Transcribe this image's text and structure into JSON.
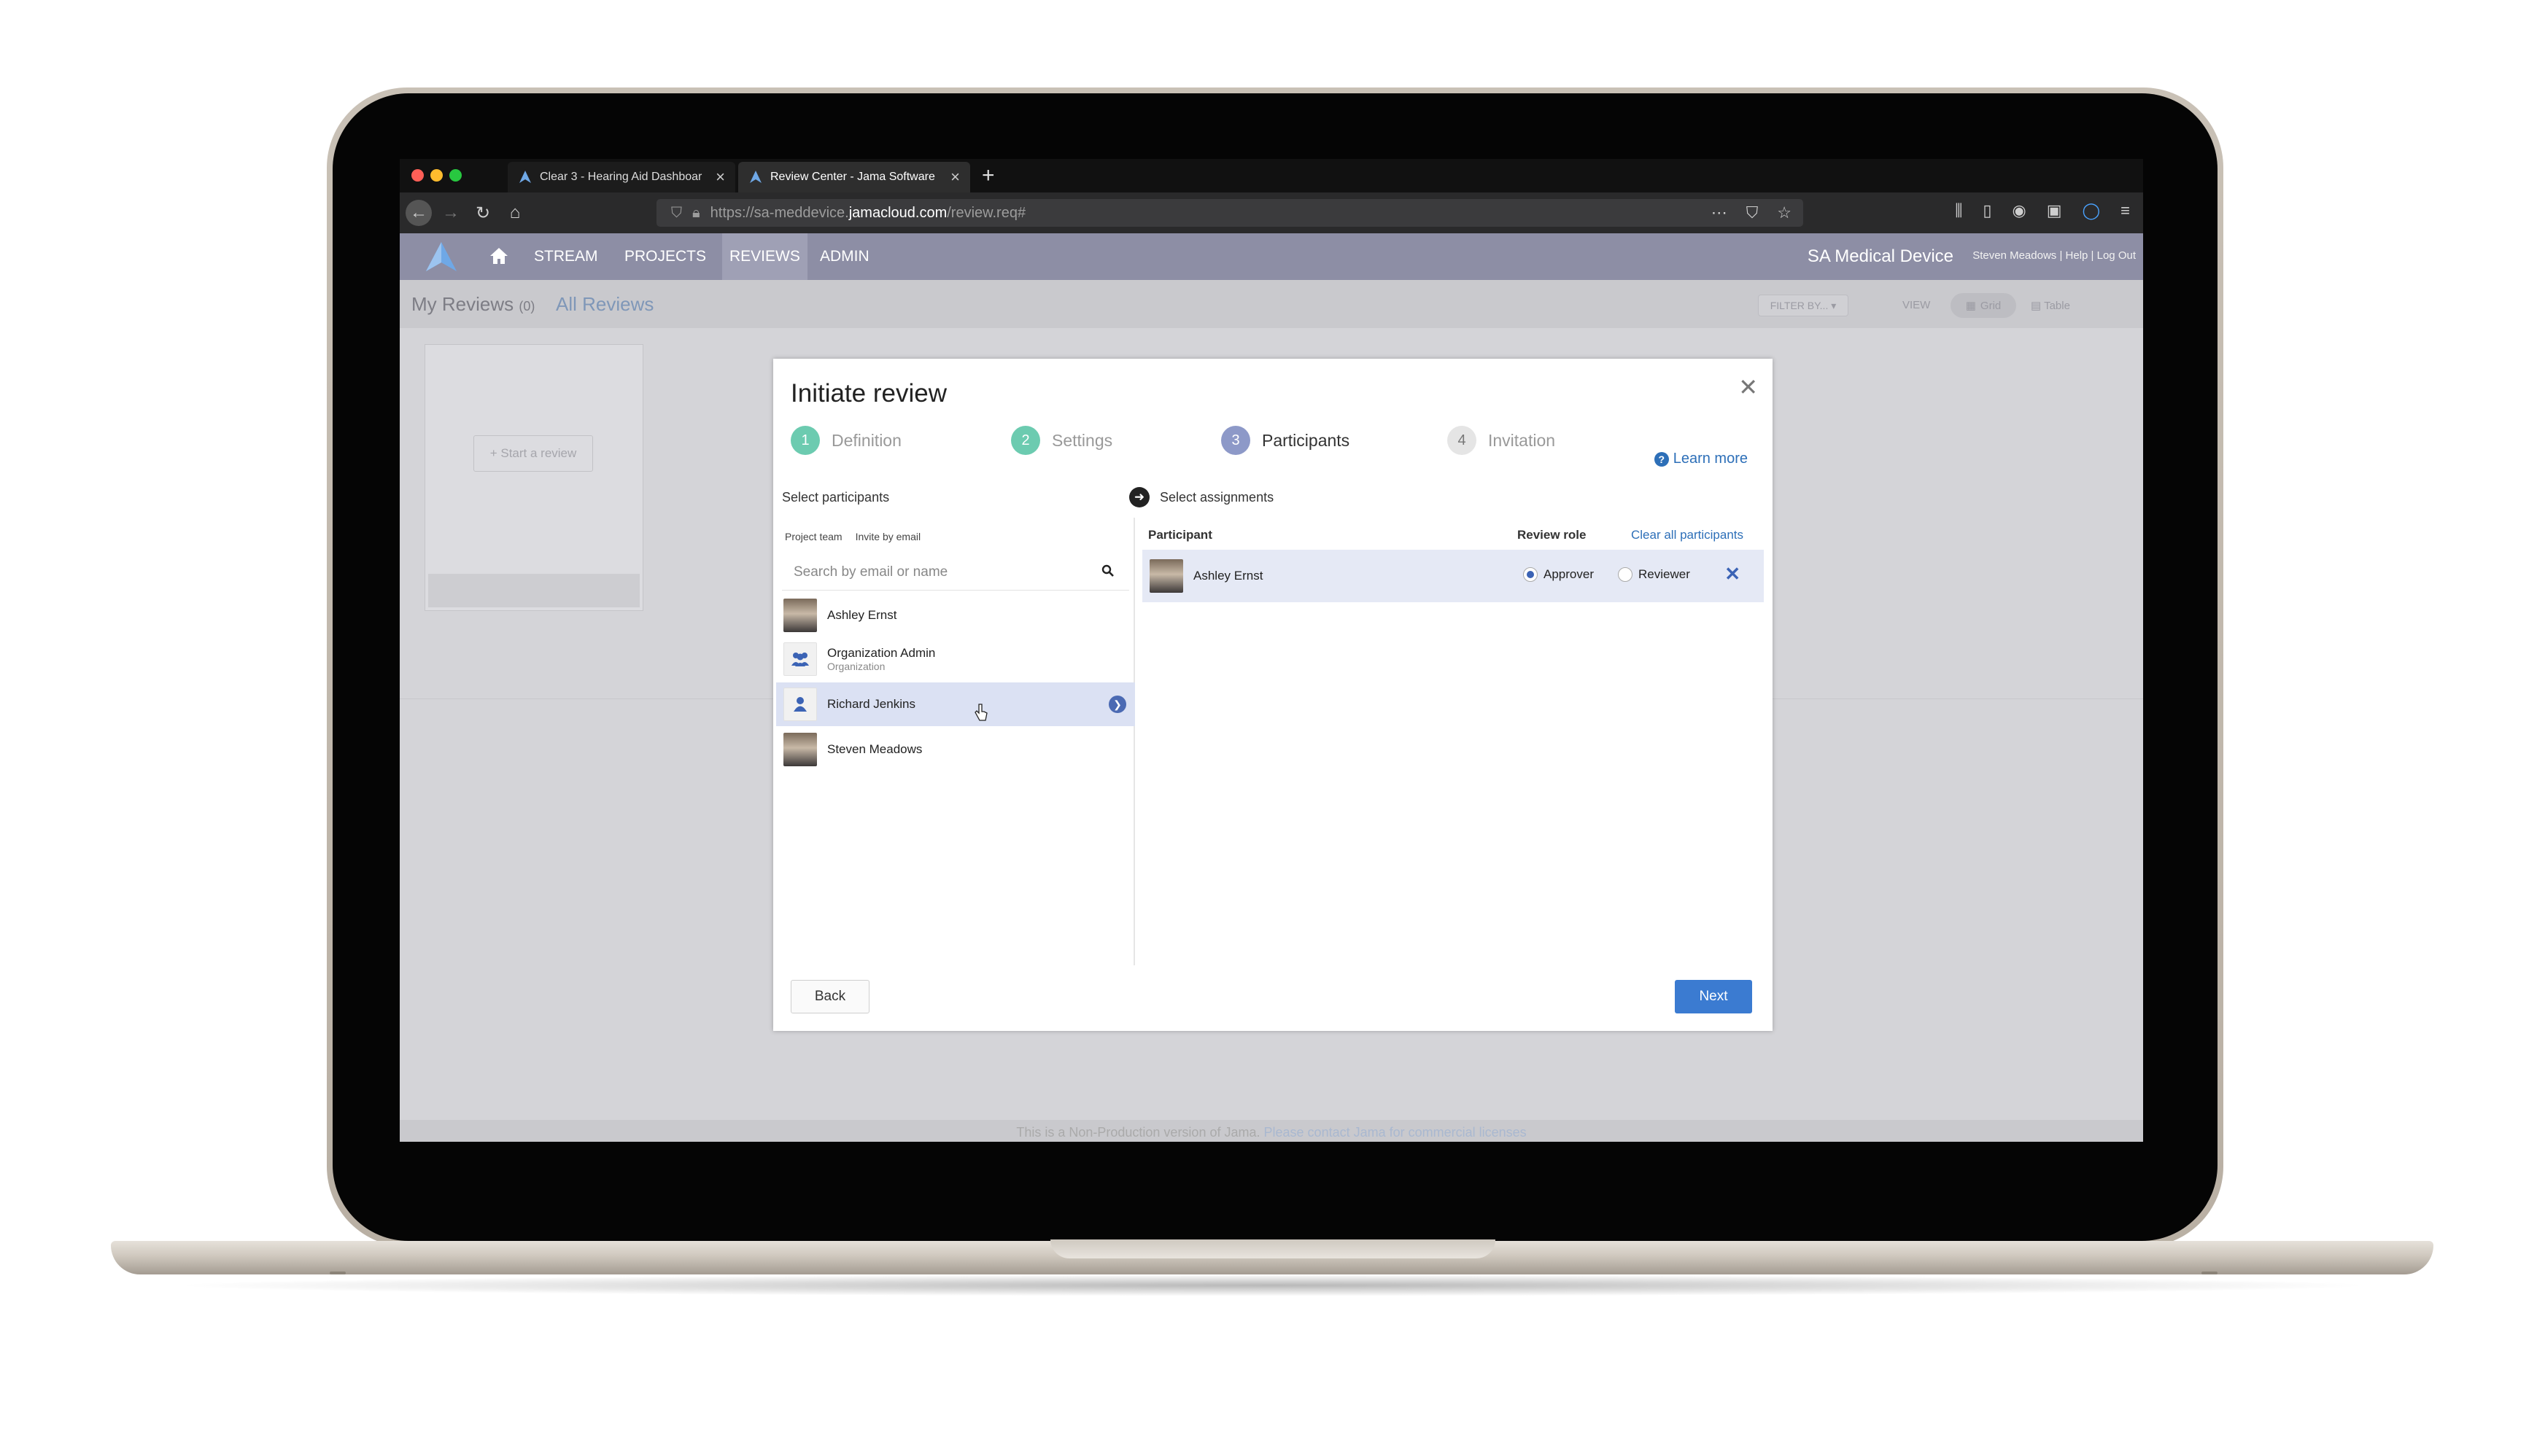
{
  "browser": {
    "tabs": [
      {
        "title": "Clear 3 - Hearing Aid Dashboar",
        "active": false
      },
      {
        "title": "Review Center - Jama Software",
        "active": true
      }
    ],
    "url": {
      "prefix": "https://sa-meddevice.",
      "host": "jamacloud.com",
      "path": "/review.req#"
    },
    "colors": {
      "close": "#ff5f57",
      "minimize": "#febc2e",
      "zoom": "#28c840"
    }
  },
  "appnav": {
    "items": [
      "STREAM",
      "PROJECTS",
      "REVIEWS",
      "ADMIN"
    ],
    "brand": "SA Medical Device",
    "user": "Steven Meadows",
    "help": "Help",
    "logout": "Log Out",
    "color": "#8d8ea5"
  },
  "reviews_header": {
    "my_reviews": "My Reviews",
    "my_reviews_count": "(0)",
    "all_reviews": "All Reviews",
    "filter": "FILTER BY... ▾",
    "view_label": "VIEW",
    "grid": "Grid",
    "table": "Table"
  },
  "background": {
    "start_review": "+ Start a review",
    "footer_text": "This is a Non-Production version of Jama.",
    "footer_link": "Please contact Jama for commercial licenses"
  },
  "modal": {
    "title": "Initiate review",
    "steps": [
      {
        "num": "1",
        "label": "Definition",
        "state": "done"
      },
      {
        "num": "2",
        "label": "Settings",
        "state": "done"
      },
      {
        "num": "3",
        "label": "Participants",
        "state": "current"
      },
      {
        "num": "4",
        "label": "Invitation",
        "state": "todo"
      }
    ],
    "learn_more": "Learn more",
    "select_participants": "Select participants",
    "select_assignments": "Select assignments",
    "participant_tabs": [
      "Project team",
      "Invite by email"
    ],
    "search_placeholder": "Search by email or name",
    "people": [
      {
        "name": "Ashley Ernst",
        "sub": ""
      },
      {
        "name": "Organization Admin",
        "sub": "Organization"
      },
      {
        "name": "Richard Jenkins",
        "sub": ""
      },
      {
        "name": "Steven Meadows",
        "sub": ""
      }
    ],
    "assignments_header": {
      "participant": "Participant",
      "role": "Review role",
      "clear": "Clear all participants"
    },
    "assignments": [
      {
        "name": "Ashley Ernst",
        "role_selected": "Approver"
      }
    ],
    "roles": [
      "Approver",
      "Reviewer"
    ],
    "back": "Back",
    "next": "Next",
    "accent": "#3b7bd1"
  }
}
